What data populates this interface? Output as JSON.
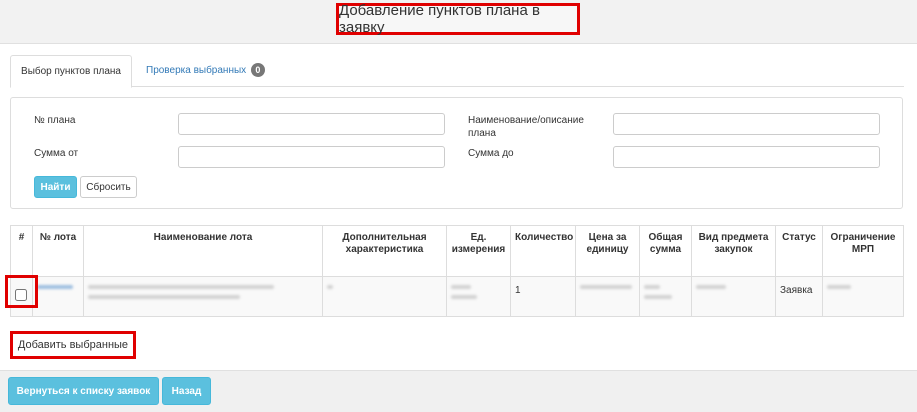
{
  "dialog": {
    "title": "Добавление пунктов плана в заявку"
  },
  "tabs": {
    "select_label": "Выбор пунктов плана",
    "review_label": "Проверка выбранных",
    "review_count": "0"
  },
  "filters": {
    "plan_no_label": "№ плана",
    "name_label": "Наименование/описание плана",
    "sum_from_label": "Сумма от",
    "sum_to_label": "Сумма до",
    "plan_no_value": "",
    "name_value": "",
    "sum_from_value": "",
    "sum_to_value": "",
    "search_button": "Найти",
    "reset_button": "Сбросить"
  },
  "table": {
    "headers": [
      "#",
      "№ лота",
      "Наименование лота",
      "Дополнительная характеристика",
      "Ед. измерения",
      "Количество",
      "Цена за единицу",
      "Общая сумма",
      "Вид предмета закупок",
      "Статус",
      "Ограничение МРП"
    ],
    "rows": [
      {
        "quantity": "1",
        "status": "Заявка"
      }
    ]
  },
  "actions": {
    "add_selected": "Добавить выбранные"
  },
  "footer": {
    "back_to_list": "Вернуться к списку заявок",
    "back": "Назад"
  },
  "colors": {
    "highlight": "#e00000",
    "accent": "#5bc0de",
    "link": "#337ab7"
  }
}
